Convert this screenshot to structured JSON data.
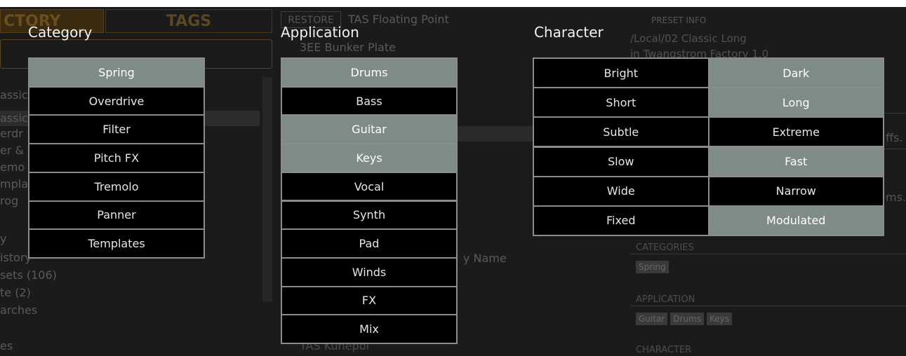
{
  "background": {
    "tabs": [
      "CTORY",
      "TAGS"
    ],
    "restore_label": "RESTORE",
    "preset_name": "TAS Floating Point",
    "browser_item": "3EE Bunker Plate",
    "name_column": "y Name",
    "bottom_item": "TAS Kunepol",
    "side_items": [
      "assic",
      "assic",
      "erdr",
      "er &",
      "emo",
      "mpla",
      "rog",
      "y",
      "istory",
      "sets (106)",
      "te (2)",
      "arches",
      "es"
    ],
    "preset_info": {
      "title": "PRESET INFO",
      "path": "/Local/02 Classic Long",
      "library": "in Twangstrom Factory 1.0",
      "trail_1": "ffs.",
      "trail_2": "ms.",
      "categories_label": "CATEGORIES",
      "categories": [
        "Spring"
      ],
      "application_label": "APPLICATION",
      "application": [
        "Guitar",
        "Drums",
        "Keys"
      ],
      "character_label": "CHARACTER"
    }
  },
  "category": {
    "title": "Category",
    "items": [
      {
        "label": "Spring",
        "selected": true
      },
      {
        "label": "Overdrive",
        "selected": false
      },
      {
        "label": "Filter",
        "selected": false
      },
      {
        "label": "Pitch FX",
        "selected": false
      },
      {
        "label": "Tremolo",
        "selected": false
      },
      {
        "label": "Panner",
        "selected": false
      },
      {
        "label": "Templates",
        "selected": false
      }
    ]
  },
  "application": {
    "title": "Application",
    "items": [
      {
        "label": "Drums",
        "selected": true
      },
      {
        "label": "Bass",
        "selected": false
      },
      {
        "label": "Guitar",
        "selected": true
      },
      {
        "label": "Keys",
        "selected": true
      },
      {
        "label": "Vocal",
        "selected": false
      },
      {
        "label": "Synth",
        "selected": false
      },
      {
        "label": "Pad",
        "selected": false
      },
      {
        "label": "Winds",
        "selected": false
      },
      {
        "label": "FX",
        "selected": false
      },
      {
        "label": "Mix",
        "selected": false
      }
    ]
  },
  "character": {
    "title": "Character",
    "pairs": [
      {
        "left": "Bright",
        "left_selected": false,
        "right": "Dark",
        "right_selected": true
      },
      {
        "left": "Short",
        "left_selected": false,
        "right": "Long",
        "right_selected": true
      },
      {
        "left": "Subtle",
        "left_selected": false,
        "right": "Extreme",
        "right_selected": false
      },
      {
        "left": "Slow",
        "left_selected": false,
        "right": "Fast",
        "right_selected": true
      },
      {
        "left": "Wide",
        "left_selected": false,
        "right": "Narrow",
        "right_selected": false
      },
      {
        "left": "Fixed",
        "left_selected": false,
        "right": "Modulated",
        "right_selected": true
      }
    ]
  }
}
